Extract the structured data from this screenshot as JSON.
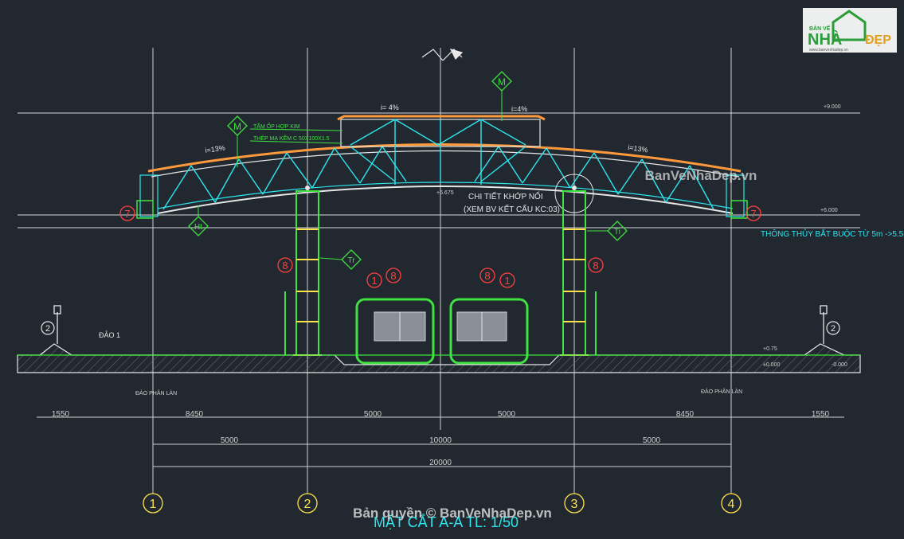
{
  "logo": {
    "top": "BẢN VẼ",
    "nha": "NHÀ",
    "dep": "ĐẸP",
    "url": "www.banvenhadep.vn"
  },
  "watermark_mid": "BanVeNhaDep.vn",
  "watermark_bottom": "Bản quyền © BanVeNhaDep.vn",
  "title": "MẶT CẮT A-A TL: 1/50",
  "roof": {
    "slope_left": "i=13%",
    "slope_right": "i=13%",
    "slope_top_left": "i= 4%",
    "slope_top_right": "i=4%",
    "material_1": "TẤM ỐP HỢP KIM",
    "material_2": "THÉP MẠ KẼM C 50X100X1.5",
    "level_mid": "+6.675",
    "joint_note_1": "CHI TIẾT KHỚP NỐI",
    "joint_note_2": "(XEM BV KẾT CẤU KC:03)",
    "clearance_note": "THÔNG THỦY BẮT BUỘC TỪ 5m ->5.5m"
  },
  "levels": {
    "top": "+9.000",
    "eave": "+6.000",
    "ground_1": "+0.75",
    "ground_2": "±0.000",
    "ground_3": "-0.000"
  },
  "tags": {
    "M": "M",
    "Ht": "Ht",
    "Tr": "Tr",
    "Ti": "Ti",
    "n1": "1",
    "n2": "2",
    "n7": "7",
    "n8": "8"
  },
  "island_label": "ĐẢO 1",
  "lane_label_left": "ĐẢO PHÂN LÀN",
  "lane_label_right": "ĐẢO PHÂN LÀN",
  "dims_row1": [
    "1550",
    "8450",
    "5000",
    "5000",
    "8450",
    "1550"
  ],
  "dims_row2": [
    "5000",
    "10000",
    "5000"
  ],
  "dims_total": "20000",
  "axes": [
    "1",
    "2",
    "3",
    "4"
  ]
}
